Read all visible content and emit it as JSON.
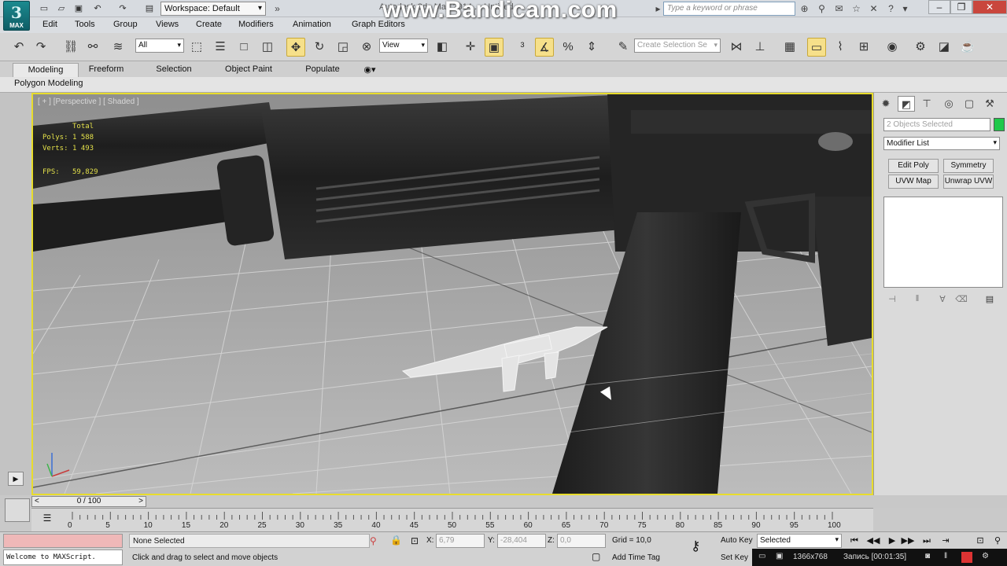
{
  "app": {
    "logo_label": "MAX",
    "workspace": "Workspace: Default",
    "window_title": "Autodesk 3ds Max 2014    ...  Untitled",
    "watermark": "www.Bandicam.com",
    "search_placeholder": "Type a keyword or phrase"
  },
  "menu": [
    "Edit",
    "Tools",
    "Group",
    "Views",
    "Create",
    "Modifiers",
    "Animation",
    "Graph Editors"
  ],
  "toolbar": {
    "selection_filter": "All",
    "ref_coord": "View",
    "named_sel_placeholder": "Create Selection Se"
  },
  "ribbon": {
    "tabs": [
      "Modeling",
      "Freeform",
      "Selection",
      "Object Paint",
      "Populate"
    ],
    "panel_label": "Polygon Modeling"
  },
  "viewport": {
    "label": "[ + ] [Perspective ] [ Shaded ]",
    "stats": {
      "total_label": "Total",
      "polys_label": "Polys:",
      "polys_value": "1 588",
      "verts_label": "Verts:",
      "verts_value": "1 493",
      "fps_label": "FPS:",
      "fps_value": "59,829"
    }
  },
  "command_panel": {
    "object_name": "2 Objects Selected",
    "modifier_list": "Modifier List",
    "buttons": [
      "Edit Poly",
      "Symmetry",
      "UVW Map",
      "Unwrap UVW"
    ],
    "object_color": "#1ec84a"
  },
  "timeline": {
    "slider": "0 / 100",
    "ticks": [
      "0",
      "5",
      "10",
      "15",
      "20",
      "25",
      "30",
      "35",
      "40",
      "45",
      "50",
      "55",
      "60",
      "65",
      "70",
      "75",
      "80",
      "85",
      "90",
      "95",
      "100"
    ]
  },
  "status": {
    "listener": "Welcome to MAXScript.",
    "selection": "None Selected",
    "prompt": "Click and drag to select and move objects",
    "x_label": "X:",
    "x_value": "6,79",
    "y_label": "Y:",
    "y_value": "-28,404",
    "z_label": "Z:",
    "z_value": "0,0",
    "grid": "Grid = 10,0",
    "add_time_tag": "Add Time Tag",
    "auto_key": "Auto Key",
    "set_key": "Set Key",
    "key_filter": "Selected"
  },
  "recorder": {
    "resolution": "1366x768",
    "recording": "Запись [00:01:35]"
  }
}
